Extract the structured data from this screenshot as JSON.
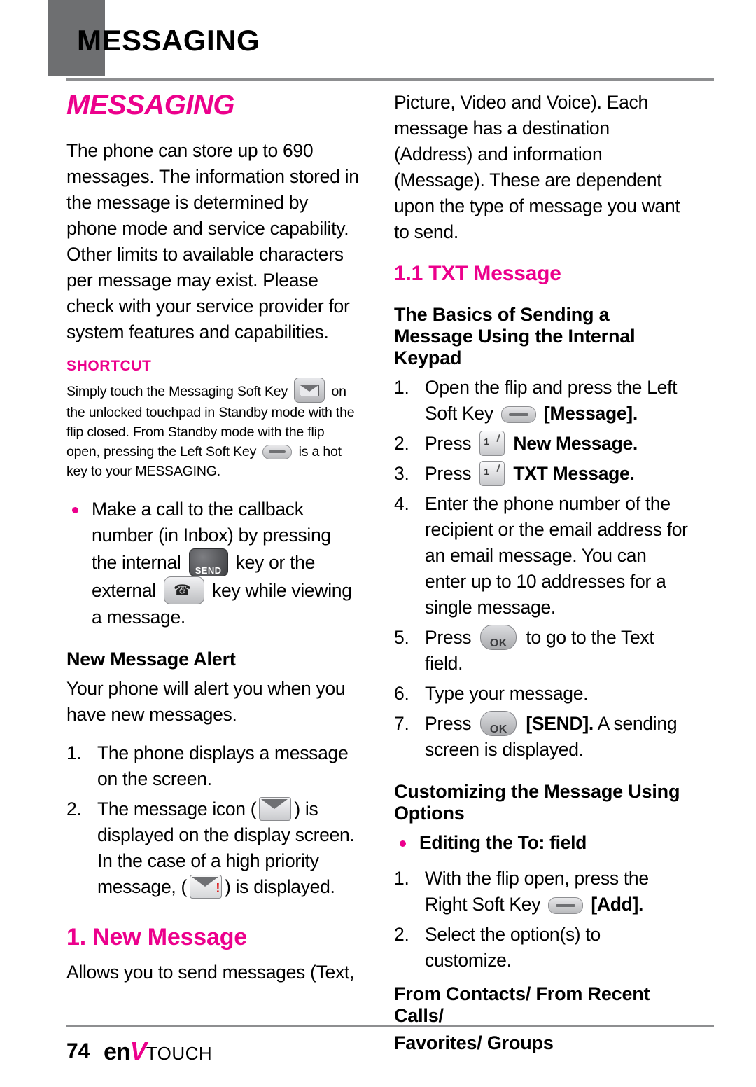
{
  "header": {
    "title": "MESSAGING"
  },
  "left_column": {
    "chapter_title": "MESSAGING",
    "intro": "The phone can store up to 690 messages. The information stored in the message is determined by phone mode and service capability. Other limits to available characters per message may exist. Please check with your service provider for system features and capabilities.",
    "shortcut_label": "SHORTCUT",
    "shortcut_parts": {
      "p1": "Simply touch the Messaging Soft Key",
      "p2": "on the unlocked touchpad in Standby mode with the flip closed. From Standby mode with the flip open, pressing the Left Soft Key",
      "p3": "is a hot key to your MESSAGING."
    },
    "bullet_parts": {
      "p1": "Make a call to the callback number (in Inbox) by pressing the internal",
      "p2": "key or the external",
      "p3": "key while viewing a message."
    },
    "new_message_alert_heading": "New Message Alert",
    "alert_intro": "Your phone will alert you when you have new messages.",
    "alert_steps": {
      "step1": "The phone displays a message on the screen.",
      "step2_p1": "The message icon (",
      "step2_p2": ") is displayed on the display screen. In the case of a high priority message, (",
      "step2_p3": ") is displayed."
    },
    "section_new_message": "1. New Message",
    "new_message_body": "Allows you to send messages (Text,"
  },
  "right_column": {
    "continuation": "Picture, Video and Voice). Each message has a destination (Address) and information (Message). These are dependent upon the type of message you want to send.",
    "section_txt_message": "1.1 TXT Message",
    "basics_heading": "The Basics of Sending a Message Using the Internal Keypad",
    "basics_steps": {
      "step1_p1": "Open the flip and press the Left Soft Key",
      "step1_p2": "[Message].",
      "step2_p1": "Press",
      "step2_p2": "New Message.",
      "step3_p1": "Press",
      "step3_p2": "TXT Message.",
      "step4": "Enter the phone number of the recipient or the email address for an email message. You can enter up to 10 addresses for a single message.",
      "step5_p1": "Press",
      "step5_p2": "to go to the Text field.",
      "step6": "Type your message.",
      "step7_p1": "Press",
      "step7_p2": "[SEND].",
      "step7_p3": "A sending screen is displayed."
    },
    "customizing_heading": "Customizing the Message Using Options",
    "editing_bullet": "Editing the To: field",
    "editing_steps": {
      "step1_p1": "With the flip open, press the Right Soft Key",
      "step1_p2": "[Add].",
      "step2": "Select the option(s) to customize."
    },
    "options_line1": "From Contacts/ From Recent Calls/",
    "options_line2": "Favorites/ Groups"
  },
  "footer": {
    "page_number": "74",
    "logo_en": "en",
    "logo_v": "V",
    "logo_touch": "TOUCH"
  },
  "icons": {
    "key1_num": "1",
    "ok_label": "OK",
    "send_label": "SEND"
  },
  "colors": {
    "accent_pink": "#ec008c",
    "rule_gray": "#8d8e90",
    "tab_gray": "#6e6f71"
  }
}
